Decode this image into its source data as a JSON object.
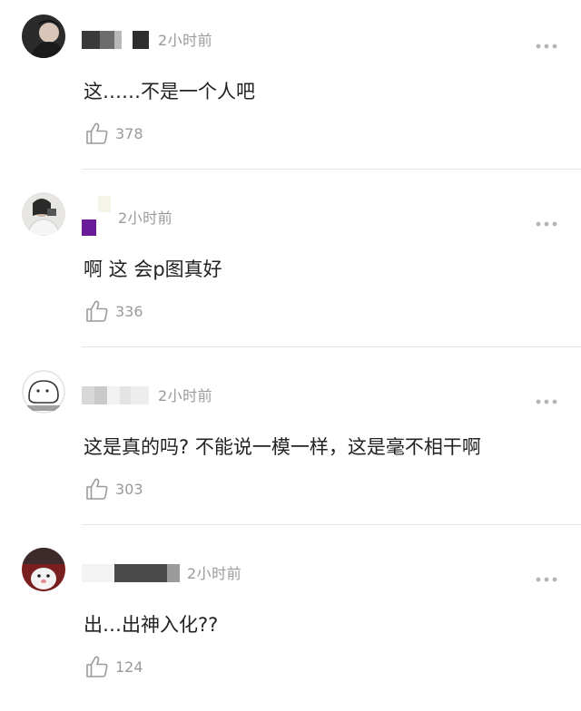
{
  "comments": [
    {
      "time": "2小时前",
      "text": "这……不是一个人吧",
      "likes": "378",
      "avatar_icon": "user-avatar-photo",
      "username_hidden": true
    },
    {
      "time": "2小时前",
      "text": "啊 这 会p图真好",
      "likes": "336",
      "avatar_icon": "user-avatar-photo",
      "username_hidden": true
    },
    {
      "time": "2小时前",
      "text": "这是真的吗? 不能说一模一样，这是毫不相干啊",
      "likes": "303",
      "avatar_icon": "user-avatar-cartoon",
      "username_hidden": true
    },
    {
      "time": "2小时前",
      "text": "出…出神入化??",
      "likes": "124",
      "avatar_icon": "user-avatar-photo",
      "username_hidden": true
    }
  ],
  "icons": {
    "like": "thumbs-up-outline-icon",
    "more": "more-dots-icon"
  },
  "colors": {
    "meta_text": "#9a9a9a",
    "body_text": "#222222",
    "divider": "#e6e6e6",
    "accent_purple": "#6a1b9a"
  }
}
